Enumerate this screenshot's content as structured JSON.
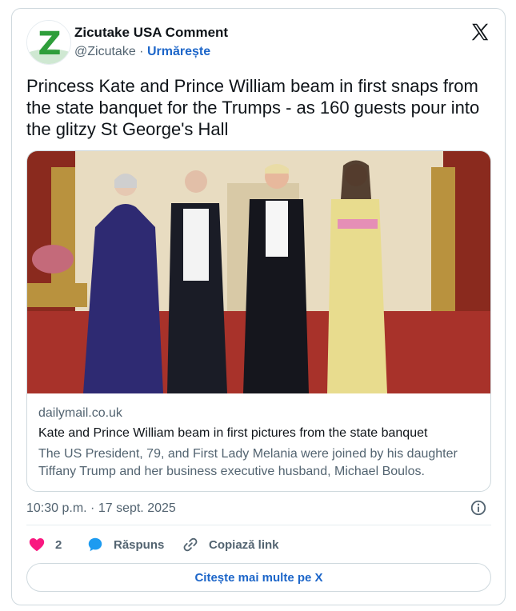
{
  "author": {
    "name": "Zicutake USA Comment",
    "handle": "@Zicutake",
    "separator": " · ",
    "follow_label": "Urmărește",
    "avatar_letter": "Z"
  },
  "tweet": {
    "text": "Princess Kate and Prince William beam in first snaps from the state banquet for the Trumps - as 160 guests pour into the glitzy St George's Hall"
  },
  "link_card": {
    "domain": "dailymail.co.uk",
    "title": "Kate and Prince William beam in first pictures from the state banquet",
    "description": "The US President, 79, and First Lady Melania were joined by his daughter Tiffany Trump and her business executive husband, Michael Boulos."
  },
  "meta": {
    "timestamp": "10:30 p.m. · 17 sept. 2025"
  },
  "actions": {
    "like_count": "2",
    "reply_label": "Răspuns",
    "copy_label": "Copiază link"
  },
  "read_more_label": "Citește mai multe pe X",
  "icons": {
    "x_logo": "x-logo-icon",
    "info": "info-icon",
    "heart": "heart-icon",
    "reply": "reply-bubble-icon",
    "link": "link-icon"
  },
  "colors": {
    "link_blue": "#1d66c9",
    "heart_pink": "#f91880",
    "reply_blue": "#1d9bf0",
    "avatar_green": "#2e9e3a"
  }
}
